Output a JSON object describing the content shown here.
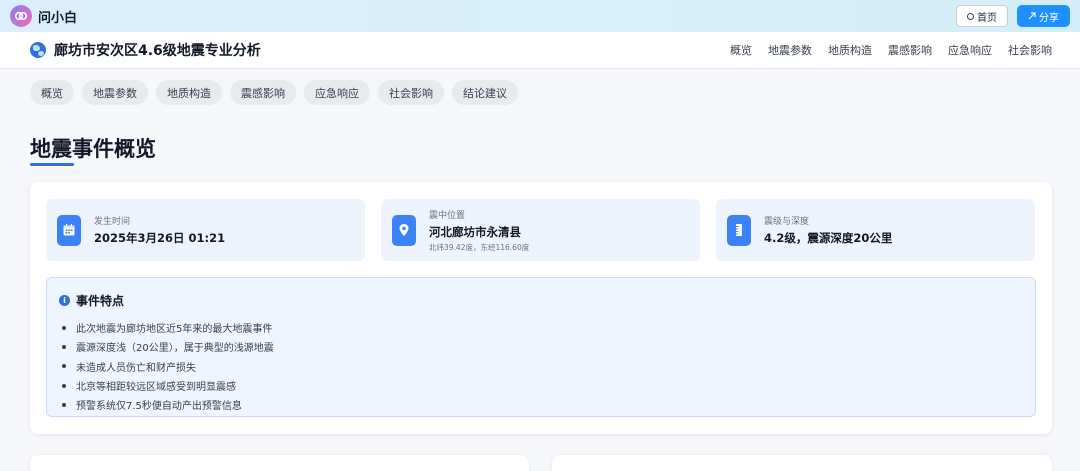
{
  "app": {
    "name": "问小白",
    "home_label": "首页",
    "share_label": "分享",
    "share_icon": "share-icon"
  },
  "header": {
    "title": "廊坊市安次区4.6级地震专业分析",
    "nav": [
      "概览",
      "地震参数",
      "地质构造",
      "震感影响",
      "应急响应",
      "社会影响"
    ]
  },
  "chips": [
    "概览",
    "地震参数",
    "地质构造",
    "震感影响",
    "应急响应",
    "社会影响",
    "结论建议"
  ],
  "section": {
    "title": "地震事件概览"
  },
  "info": [
    {
      "label": "发生时间",
      "value": "2025年3月26日 01:21",
      "sub": "",
      "icon": "calendar-icon"
    },
    {
      "label": "震中位置",
      "value": "河北廊坊市永清县",
      "sub": "北纬39.42度，东经116.60度",
      "icon": "location-pin-icon"
    },
    {
      "label": "震级与深度",
      "value": "4.2级，震源深度20公里",
      "sub": "",
      "icon": "ruler-icon"
    }
  ],
  "features": {
    "title": "事件特点",
    "items": [
      "此次地震为廊坊地区近5年来的最大地震事件",
      "震源深度浅（20公里），属于典型的浅源地震",
      "未造成人员伤亡和财产损失",
      "北京等相距较远区域感受到明显震感",
      "预警系统仅7.5秒便自动产出预警信息"
    ]
  },
  "colors": {
    "accent": "#2f6fde",
    "share_button": "#1e90ff",
    "info_bg": "#eef4fd"
  }
}
